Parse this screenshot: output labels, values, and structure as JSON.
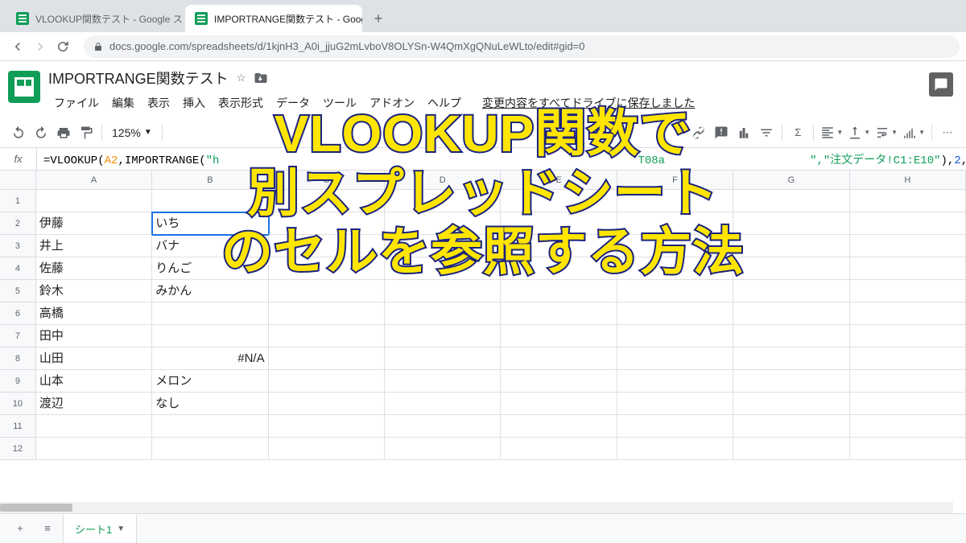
{
  "browser": {
    "tabs": [
      {
        "title": "VLOOKUP関数テスト - Google スプ"
      },
      {
        "title": "IMPORTRANGE関数テスト - Goog"
      }
    ],
    "url": "docs.google.com/spreadsheets/d/1kjnH3_A0i_jjuG2mLvboV8OLYSn-W4QmXgQNuLeWLto/edit#gid=0"
  },
  "doc": {
    "title": "IMPORTRANGE関数テスト",
    "menus": [
      "ファイル",
      "編集",
      "表示",
      "挿入",
      "表示形式",
      "データ",
      "ツール",
      "アドオン",
      "ヘルプ"
    ],
    "save_status": "変更内容をすべてドライブに保存しました"
  },
  "toolbar": {
    "zoom": "125%"
  },
  "formula": {
    "fx": "fx",
    "prefix": "=VLOOKUP(",
    "ref": "A2",
    "mid1": ",IMPORTRANGE(",
    "str1": "\"h",
    "mid_gap": "T08a",
    "str2": "\",\"注文データ!C1:E10\"",
    "mid2": "),",
    "num": "2",
    "mid3": ",",
    "bool": "false",
    "end": ")"
  },
  "columns": [
    "A",
    "B",
    "C",
    "D",
    "E",
    "F",
    "G",
    "H"
  ],
  "row_nums": [
    "1",
    "2",
    "3",
    "4",
    "5",
    "6",
    "7",
    "8",
    "9",
    "10",
    "11",
    "12"
  ],
  "cells": {
    "A": [
      "",
      "伊藤",
      "井上",
      "佐藤",
      "鈴木",
      "高橋",
      "田中",
      "山田",
      "山本",
      "渡辺",
      "",
      ""
    ],
    "B": [
      "",
      "いち",
      "バナ",
      "りんご",
      "みかん",
      "",
      "",
      "#N/A",
      "メロン",
      "なし",
      "",
      ""
    ]
  },
  "sheet_tab": {
    "name": "シート1"
  },
  "overlay": {
    "l1": "VLOOKUP関数で",
    "l2": "別スプレッドシート",
    "l3": "のセルを参照する方法"
  }
}
